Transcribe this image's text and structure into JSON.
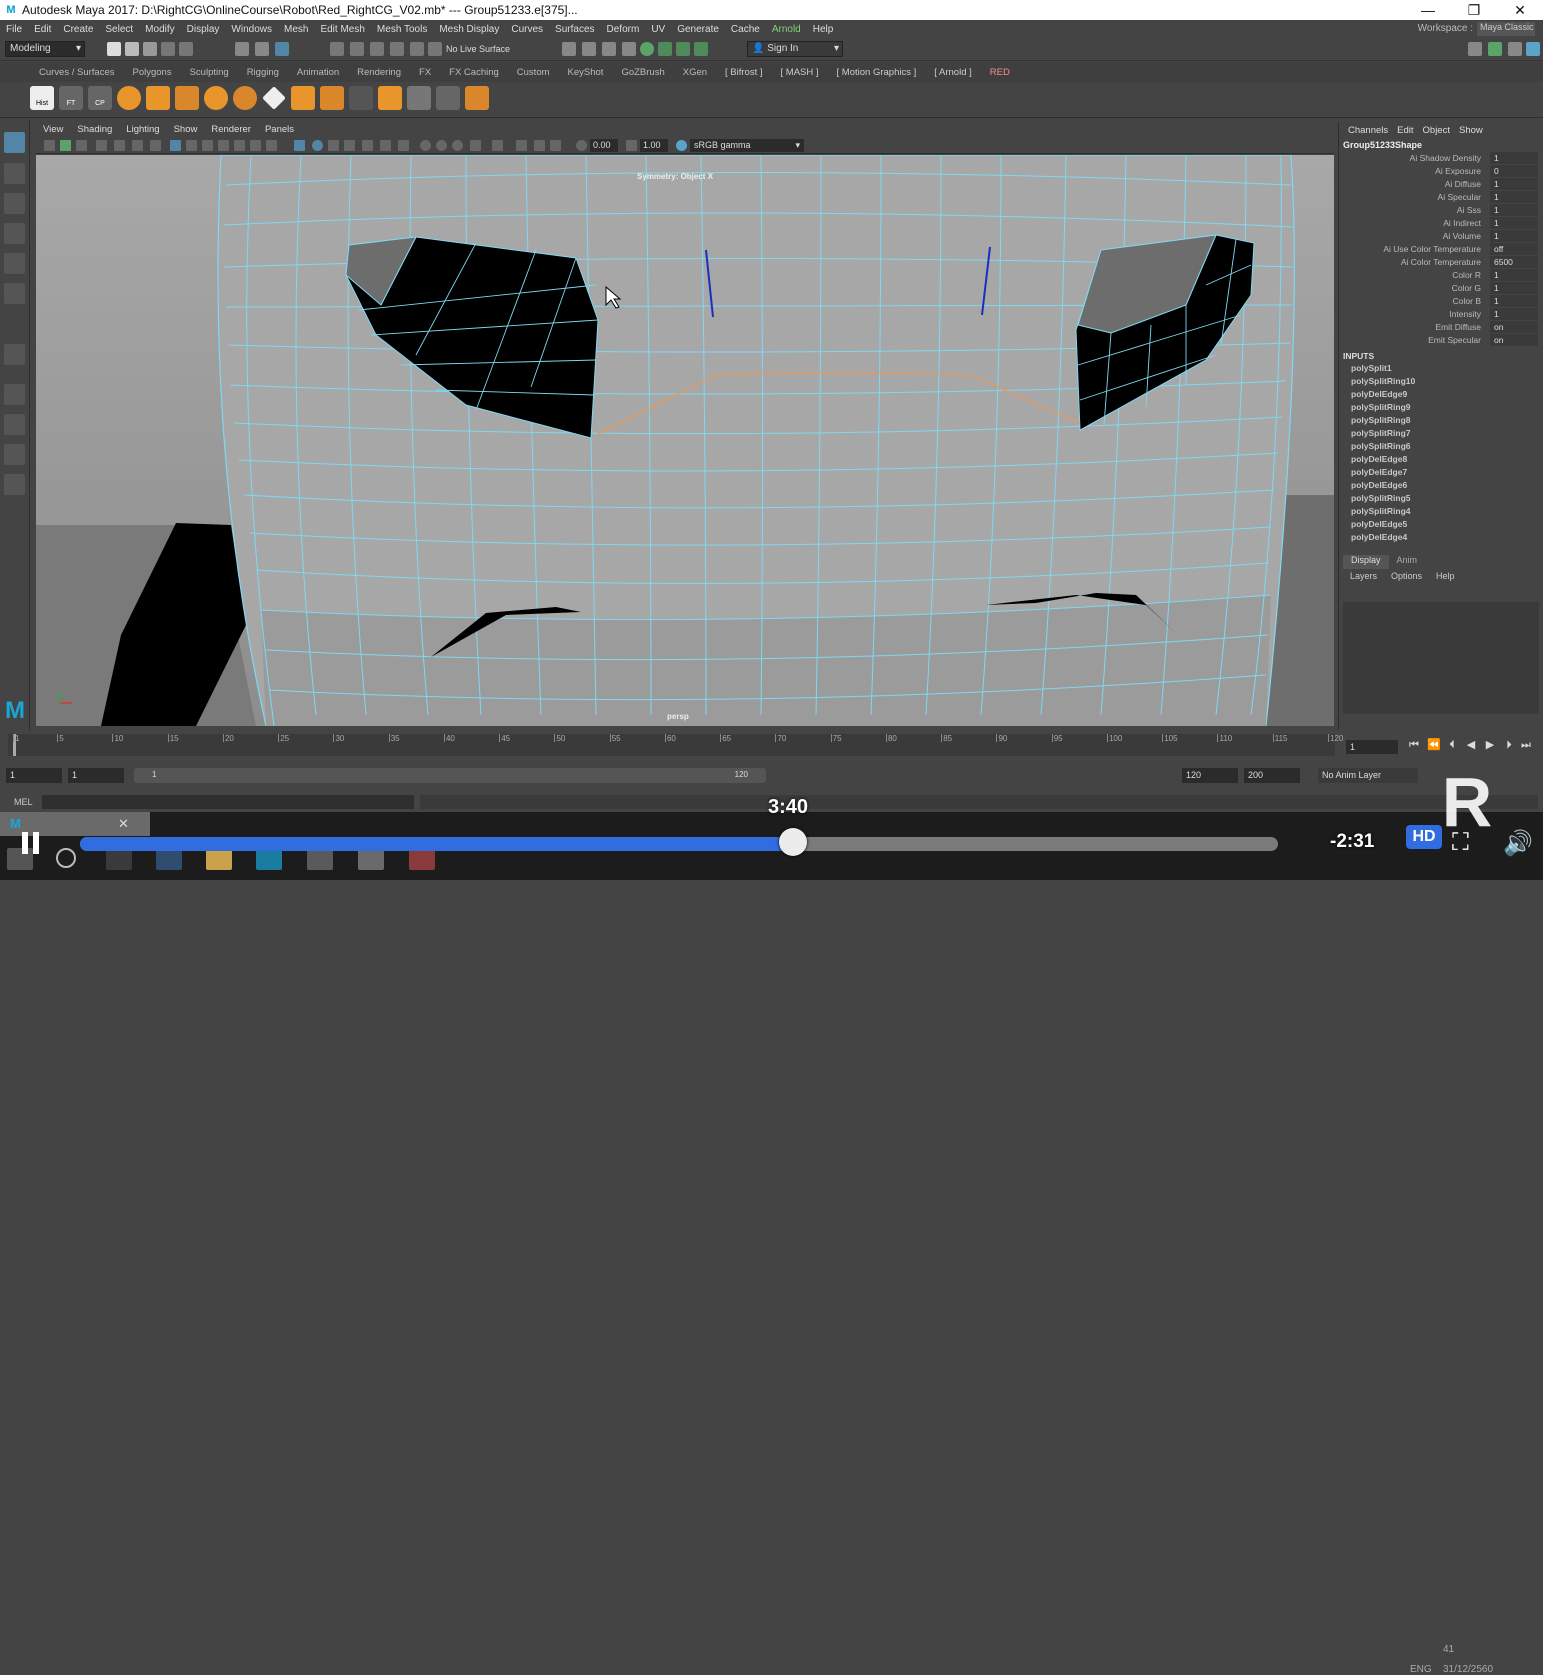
{
  "window": {
    "title": "Autodesk Maya 2017: D:\\RightCG\\OnlineCourse\\Robot\\Red_RightCG_V02.mb*   ---   Group51233.e[375]...",
    "logo_letter": "M",
    "min_glyph": "—",
    "max_glyph": "❐",
    "close_glyph": "✕"
  },
  "menu": [
    "File",
    "Edit",
    "Create",
    "Select",
    "Modify",
    "Display",
    "Windows",
    "Mesh",
    "Edit Mesh",
    "Mesh Tools",
    "Mesh Display",
    "Curves",
    "Surfaces",
    "Deform",
    "UV",
    "Generate",
    "Cache",
    "Arnold",
    "Help"
  ],
  "workspace": {
    "label": "Workspace :",
    "value": "Maya Classic"
  },
  "status_line": {
    "mode": "Modeling",
    "live_surface": "No Live Surface",
    "sign_in": "Sign In"
  },
  "shelf_tabs": [
    "Curves / Surfaces",
    "Polygons",
    "Sculpting",
    "Rigging",
    "Animation",
    "Rendering",
    "FX",
    "FX Caching",
    "Custom",
    "KeyShot",
    "GoZBrush",
    "XGen",
    "[ Bifrost ]",
    "[ MASH ]",
    "[ Motion Graphics ]",
    "[ Arnold ]",
    "RED"
  ],
  "shelf_icons": [
    "Hist",
    "FT",
    "CP"
  ],
  "viewport": {
    "menu": [
      "View",
      "Shading",
      "Lighting",
      "Show",
      "Renderer",
      "Panels"
    ],
    "field_a": "0.00",
    "field_b": "1.00",
    "color_space": "sRGB gamma",
    "symmetry_label": "Symmetry: Object X",
    "camera": "persp"
  },
  "channel_box": {
    "menu": [
      "Channels",
      "Edit",
      "Object",
      "Show"
    ],
    "object": "Group51233Shape",
    "attributes": [
      {
        "name": "Ai Shadow Density",
        "value": "1"
      },
      {
        "name": "Ai Exposure",
        "value": "0"
      },
      {
        "name": "Ai Diffuse",
        "value": "1"
      },
      {
        "name": "Ai Specular",
        "value": "1"
      },
      {
        "name": "Ai Sss",
        "value": "1"
      },
      {
        "name": "Ai Indirect",
        "value": "1"
      },
      {
        "name": "Ai Volume",
        "value": "1"
      },
      {
        "name": "Ai Use Color Temperature",
        "value": "off"
      },
      {
        "name": "Ai Color Temperature",
        "value": "6500"
      },
      {
        "name": "Color R",
        "value": "1"
      },
      {
        "name": "Color G",
        "value": "1"
      },
      {
        "name": "Color B",
        "value": "1"
      },
      {
        "name": "Intensity",
        "value": "1"
      },
      {
        "name": "Emit Diffuse",
        "value": "on"
      },
      {
        "name": "Emit Specular",
        "value": "on"
      }
    ],
    "inputs_label": "INPUTS",
    "inputs": [
      "polySplit1",
      "polySplitRing10",
      "polyDelEdge9",
      "polySplitRing9",
      "polySplitRing8",
      "polySplitRing7",
      "polySplitRing6",
      "polyDelEdge8",
      "polyDelEdge7",
      "polyDelEdge6",
      "polySplitRing5",
      "polySplitRing4",
      "polyDelEdge5",
      "polyDelEdge4"
    ],
    "layer_tabs": [
      "Display",
      "Anim"
    ],
    "layer_menu": [
      "Layers",
      "Options",
      "Help"
    ]
  },
  "time_slider": {
    "ticks": [
      "1",
      "5",
      "10",
      "15",
      "20",
      "25",
      "30",
      "35",
      "40",
      "45",
      "50",
      "55",
      "60",
      "65",
      "70",
      "75",
      "80",
      "85",
      "90",
      "95",
      "100",
      "105",
      "110",
      "115",
      "120"
    ],
    "current_frame": "1"
  },
  "range_slider": {
    "start": "1",
    "start2": "1",
    "bar_start": "1",
    "bar_end": "120",
    "end": "120",
    "end2": "200",
    "anim_layer": "No Anim Layer"
  },
  "mel": {
    "label": "MEL"
  },
  "video_overlay": {
    "hover_time": "3:40",
    "remaining": "-2:31",
    "quality": "HD",
    "progress_fraction": 0.595,
    "logo_letter": "R"
  },
  "tray": {
    "lang": "ENG",
    "date": "31/12/2560",
    "time": "41"
  }
}
